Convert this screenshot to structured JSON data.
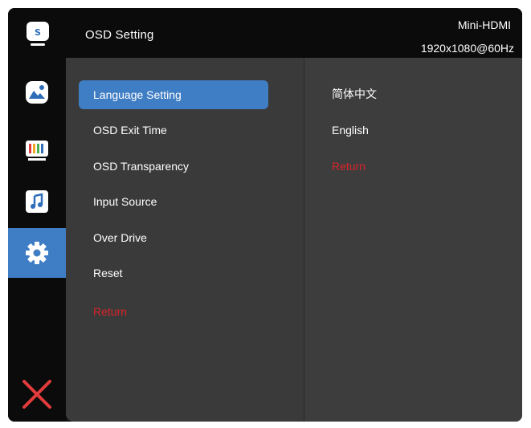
{
  "header": {
    "title": "OSD Setting",
    "input_source": "Mini-HDMI",
    "resolution": "1920x1080@60Hz",
    "badge_letter": "S"
  },
  "sidebar": {
    "items": [
      {
        "icon": "picture-icon",
        "active": false
      },
      {
        "icon": "color-bars-icon",
        "active": false
      },
      {
        "icon": "music-note-icon",
        "active": false
      },
      {
        "icon": "gear-icon",
        "active": true
      },
      {
        "icon": "close-icon",
        "active": false
      }
    ]
  },
  "menu": {
    "items": [
      {
        "label": "Language Setting",
        "selected": true
      },
      {
        "label": "OSD Exit Time",
        "selected": false
      },
      {
        "label": "OSD Transparency",
        "selected": false
      },
      {
        "label": "Input Source",
        "selected": false
      },
      {
        "label": "Over Drive",
        "selected": false
      },
      {
        "label": "Reset",
        "selected": false
      },
      {
        "label": "Return",
        "selected": false
      }
    ]
  },
  "options": {
    "items": [
      {
        "label": "简体中文"
      },
      {
        "label": "English"
      },
      {
        "label": "Return"
      }
    ]
  },
  "colors": {
    "accent": "#3f7dc4",
    "return_red": "#d9242a",
    "close_red": "#e23b3b",
    "background": "#111111",
    "menu_panel": "#3a3a3a"
  }
}
